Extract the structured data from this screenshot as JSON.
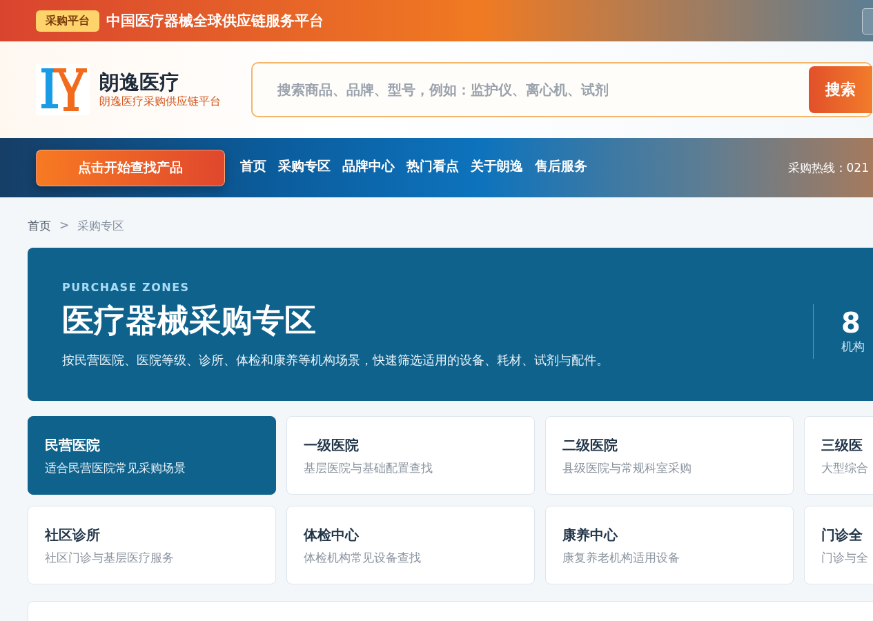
{
  "top_bar": {
    "badge": "采购平台",
    "title": "中国医疗器械全球供应链服务平台"
  },
  "header": {
    "brand_name": "朗逸医疗",
    "brand_tagline": "朗逸医疗采购供应链平台",
    "search": {
      "placeholder": "搜索商品、品牌、型号，例如：监护仪、离心机、试剂",
      "button": "搜索"
    }
  },
  "nav": {
    "cta": "点击开始查找产品",
    "items": [
      {
        "label": "首页",
        "selected": false
      },
      {
        "label": "采购专区",
        "selected": false
      },
      {
        "label": "品牌中心",
        "selected": false
      },
      {
        "label": "热门看点",
        "selected": false
      },
      {
        "label": "关于朗逸",
        "selected": false
      },
      {
        "label": "售后服务",
        "selected": false
      }
    ],
    "hotline": "采购热线：021"
  },
  "breadcrumb": {
    "separator": ">",
    "items": [
      {
        "label": "首页"
      },
      {
        "label": "采购专区"
      }
    ]
  },
  "hero": {
    "eyebrow": "PURCHASE ZONES",
    "title": "医疗器械采购专区",
    "description": "按民营医院、医院等级、诊所、体检和康养等机构场景，快速筛选适用的设备、耗材、试剂与配件。",
    "stat": {
      "value": "8",
      "label": "机构"
    }
  },
  "zones": [
    {
      "title": "民营医院",
      "subtitle": "适合民营医院常见采购场景",
      "selected": true
    },
    {
      "title": "一级医院",
      "subtitle": "基层医院与基础配置查找",
      "selected": false
    },
    {
      "title": "二级医院",
      "subtitle": "县级医院与常规科室采购",
      "selected": false
    },
    {
      "title": "三级医",
      "subtitle": "大型综合",
      "selected": false
    },
    {
      "title": "社区诊所",
      "subtitle": "社区门诊与基层医疗服务",
      "selected": false
    },
    {
      "title": "体检中心",
      "subtitle": "体检机构常见设备查找",
      "selected": false
    },
    {
      "title": "康养中心",
      "subtitle": "康复养老机构适用设备",
      "selected": false
    },
    {
      "title": "门诊全",
      "subtitle": "门诊与全",
      "selected": false
    }
  ]
}
